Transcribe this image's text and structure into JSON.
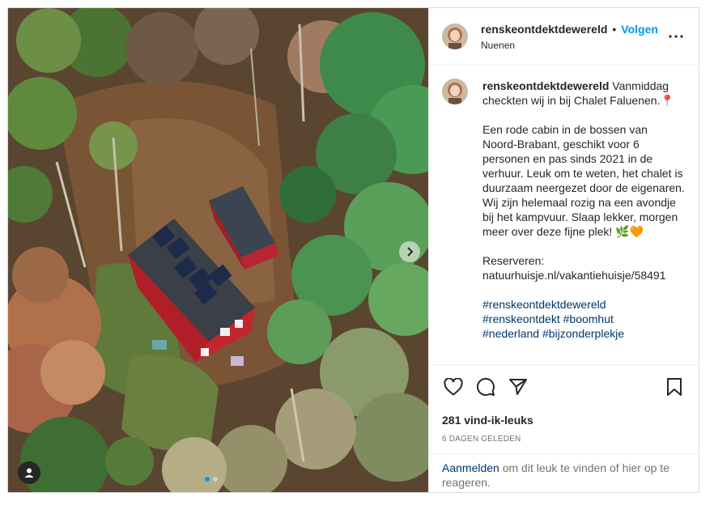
{
  "post": {
    "username": "renskeontdektdewereld",
    "separator": "•",
    "follow_label": "Volgen",
    "location": "Nuenen"
  },
  "caption": {
    "username": "renskeontdektdewereld",
    "intro": "Vanmiddag checkten wij in bij Chalet Faluenen.📍",
    "body": "Een rode cabin in de bossen van Noord-Brabant, geschikt voor 6 personen en pas sinds 2021 in de verhuur. Leuk om te weten, het chalet is duurzaam neergezet door de eigenaren. Wij zijn helemaal rozig na een avondje bij het kampvuur. Slaap lekker, morgen meer over deze fijne plek! 🌿🧡",
    "reserve_label": "Reserveren:",
    "reserve_link": "natuurhuisje.nl/vakantiehuisje/58491",
    "hashtags": [
      "#renskeontdektdewereld",
      "#renskeontdekt",
      "#boomhut",
      "#nederland",
      "#bijzonderplekje"
    ]
  },
  "engagement": {
    "likes": "281 vind-ik-leuks",
    "time_ago": "6 DAGEN GELEDEN"
  },
  "login_prompt": {
    "link": "Aanmelden",
    "text": " om dit leuk te vinden of hier op te reageren."
  },
  "icons": {
    "more": "more-options-icon",
    "like": "heart-icon",
    "comment": "comment-icon",
    "share": "share-icon",
    "save": "bookmark-icon",
    "next": "chevron-right-icon",
    "tags": "user-tag-icon"
  },
  "colors": {
    "accent": "#0095f6",
    "hashtag": "#00376b",
    "muted": "#737373",
    "border": "#dbdbdb"
  }
}
